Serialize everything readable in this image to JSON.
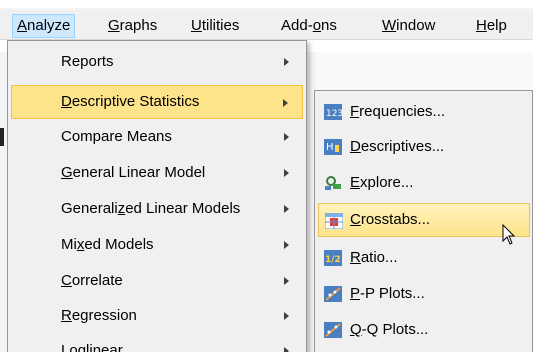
{
  "title_partial": "",
  "menubar": {
    "items": [
      {
        "label": "Analyze",
        "underline_index": 0
      },
      {
        "label": "Graphs",
        "underline_index": 0
      },
      {
        "label": "Utilities",
        "underline_index": 0
      },
      {
        "label": "Add-ons",
        "underline_index": 4
      },
      {
        "label": "Window",
        "underline_index": 0
      },
      {
        "label": "Help",
        "underline_index": 0
      }
    ],
    "active": "Analyze"
  },
  "analyze_menu": {
    "items": [
      {
        "label": "Reports",
        "has_submenu": true
      },
      {
        "label": "Descriptive Statistics",
        "has_submenu": true,
        "highlighted": true
      },
      {
        "label": "Compare Means",
        "has_submenu": true
      },
      {
        "label": "General Linear Model",
        "has_submenu": true
      },
      {
        "label": "Generalized Linear Models",
        "has_submenu": true
      },
      {
        "label": "Mixed Models",
        "has_submenu": true
      },
      {
        "label": "Correlate",
        "has_submenu": true
      },
      {
        "label": "Regression",
        "has_submenu": true
      },
      {
        "label": "Loglinear",
        "has_submenu": true
      }
    ]
  },
  "descriptive_submenu": {
    "items": [
      {
        "label": "Frequencies...",
        "icon": "frequencies-icon"
      },
      {
        "label": "Descriptives...",
        "icon": "descriptives-icon"
      },
      {
        "label": "Explore...",
        "icon": "explore-icon"
      },
      {
        "label": "Crosstabs...",
        "icon": "crosstabs-icon",
        "highlighted": true
      },
      {
        "label": "Ratio...",
        "icon": "ratio-icon"
      },
      {
        "label": "P-P Plots...",
        "icon": "pp-plots-icon"
      },
      {
        "label": "Q-Q Plots...",
        "icon": "qq-plots-icon"
      }
    ]
  },
  "colors": {
    "menu_bg": "#f0f0f0",
    "menubar_active": "#cce8ff",
    "highlight": "#fde38a",
    "highlight_border": "#f5c246"
  }
}
